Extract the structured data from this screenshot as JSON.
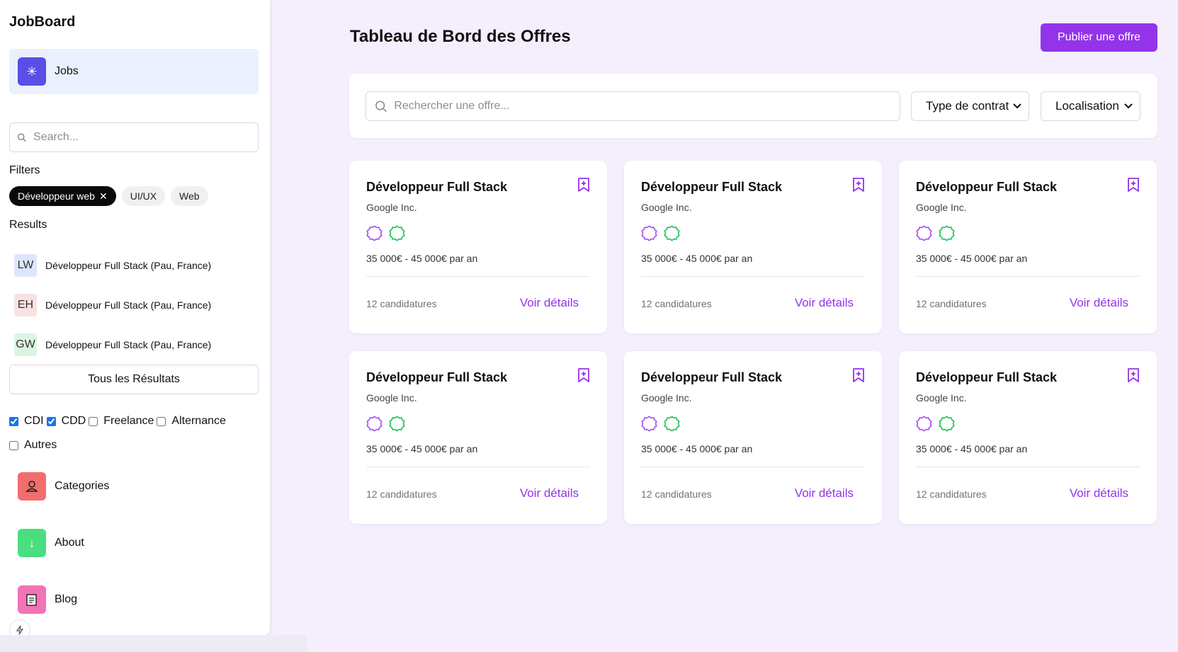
{
  "sidebar": {
    "brand": "JobBoard",
    "nav_jobs": {
      "label": "Jobs",
      "icon": "asterisk-icon",
      "color": "#5b4ee6"
    },
    "search_placeholder": "Search...",
    "filters_label": "Filters",
    "chips": [
      {
        "label": "Développeur web",
        "active": true
      },
      {
        "label": "UI/UX",
        "active": false
      },
      {
        "label": "Web",
        "active": false
      }
    ],
    "results_label": "Results",
    "results": [
      {
        "initials": "LW",
        "text": "Développeur Full Stack (Pau, France)",
        "color": "#dbe7fb"
      },
      {
        "initials": "EH",
        "text": "Développeur Full Stack (Pau, France)",
        "color": "#fbe2e2"
      },
      {
        "initials": "GW",
        "text": "Développeur Full Stack (Pau, France)",
        "color": "#dcf5e1"
      }
    ],
    "all_results_label": "Tous les Résultats",
    "contract_checks": [
      {
        "label": "CDI",
        "checked": true
      },
      {
        "label": "CDD",
        "checked": true
      },
      {
        "label": "Freelance",
        "checked": false
      },
      {
        "label": "Alternance",
        "checked": false
      },
      {
        "label": "Autres",
        "checked": false
      }
    ],
    "nav_items": [
      {
        "label": "Categories",
        "icon": "user-icon",
        "color": "#f26d6d"
      },
      {
        "label": "About",
        "icon": "arrow-down-icon",
        "color": "#4ade80"
      },
      {
        "label": "Blog",
        "icon": "notepad-icon",
        "color": "#f472b6"
      }
    ]
  },
  "header": {
    "title": "Tableau de Bord des Offres",
    "publish_label": "Publier une offre",
    "accent": "#9333ea"
  },
  "filters": {
    "search_placeholder": "Rechercher une offre...",
    "contract_select": "Type de contrat",
    "location_select": "Localisation"
  },
  "jobs": [
    {
      "title": "Développeur Full Stack",
      "company": "Google Inc.",
      "salary": "35 000€ - 45 000€ par an",
      "applications": "12 candidatures",
      "details_label": "Voir détails"
    },
    {
      "title": "Développeur Full Stack",
      "company": "Google Inc.",
      "salary": "35 000€ - 45 000€ par an",
      "applications": "12 candidatures",
      "details_label": "Voir détails"
    },
    {
      "title": "Développeur Full Stack",
      "company": "Google Inc.",
      "salary": "35 000€ - 45 000€ par an",
      "applications": "12 candidatures",
      "details_label": "Voir détails"
    },
    {
      "title": "Développeur Full Stack",
      "company": "Google Inc.",
      "salary": "35 000€ - 45 000€ par an",
      "applications": "12 candidatures",
      "details_label": "Voir détails"
    },
    {
      "title": "Développeur Full Stack",
      "company": "Google Inc.",
      "salary": "35 000€ - 45 000€ par an",
      "applications": "12 candidatures",
      "details_label": "Voir détails"
    },
    {
      "title": "Développeur Full Stack",
      "company": "Google Inc.",
      "salary": "35 000€ - 45 000€ par an",
      "applications": "12 candidatures",
      "details_label": "Voir détails"
    }
  ]
}
